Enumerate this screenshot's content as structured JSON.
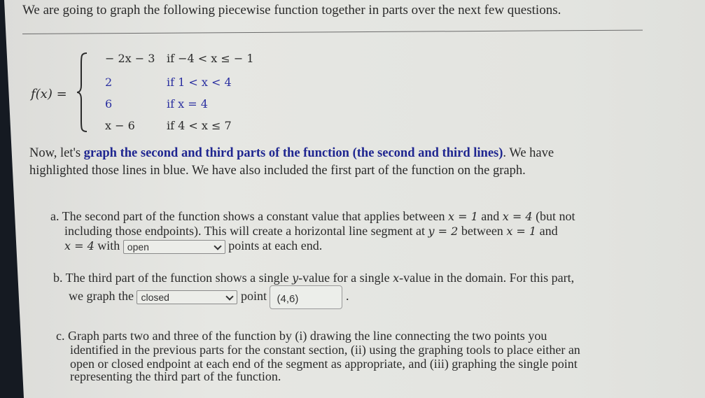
{
  "intro": "We are going to graph the following piecewise function together in parts over the next few questions.",
  "function": {
    "name": "f(x) =",
    "pieces": [
      {
        "expr": "− 2x − 3",
        "cond": "if −4 < x ≤ − 1",
        "highlighted": false
      },
      {
        "expr": "2",
        "cond": "if 1 < x < 4",
        "highlighted": true
      },
      {
        "expr": "6",
        "cond": "if x = 4",
        "highlighted": true
      },
      {
        "expr": "x − 6",
        "cond": "if 4 < x ≤ 7",
        "highlighted": false
      }
    ]
  },
  "instruction": {
    "lead": "Now, let's ",
    "bold": "graph the second and third parts of the function (the second and third lines)",
    "tail1": ". We have",
    "line2": "highlighted those lines in blue. We have also included the first part of the function on the graph."
  },
  "part_a": {
    "line1_a": "a. The second part of the function shows a constant value that applies between ",
    "x_eq_1": "x = 1",
    "and": " and ",
    "x_eq_4": "x = 4",
    "line1_b": " (but not",
    "line2_a": "including those endpoints). This will create a horizontal line segment at ",
    "y_eq_2": "y = 2",
    "line2_b": " between ",
    "line2_x1": "x = 1",
    "line2_c": " and",
    "line3_x4": "x = 4",
    "line3_a": " with ",
    "select_value": "open",
    "line3_b": " points at each end."
  },
  "part_b": {
    "line1_a": "b. The third part of the function shows a single ",
    "y": "y",
    "line1_b": "-value for a single ",
    "x": "x",
    "line1_c": "-value in the domain. For this part,",
    "line2_a": "we graph the ",
    "select_value": "closed",
    "line2_b": " point ",
    "answer": "(4,6)",
    "period": "."
  },
  "part_c": {
    "lines": [
      "c. Graph parts two and three of the function by (i) drawing the line connecting the two points you",
      "identified in the previous parts for the constant section, (ii) using the graphing tools to place either an",
      "open or closed endpoint at each end of the segment as appropriate, and (iii) graphing the single point",
      "representing the third part of the function."
    ]
  },
  "colors": {
    "highlight_blue": "#2a2fa0",
    "bold_blue": "#1f2690"
  }
}
